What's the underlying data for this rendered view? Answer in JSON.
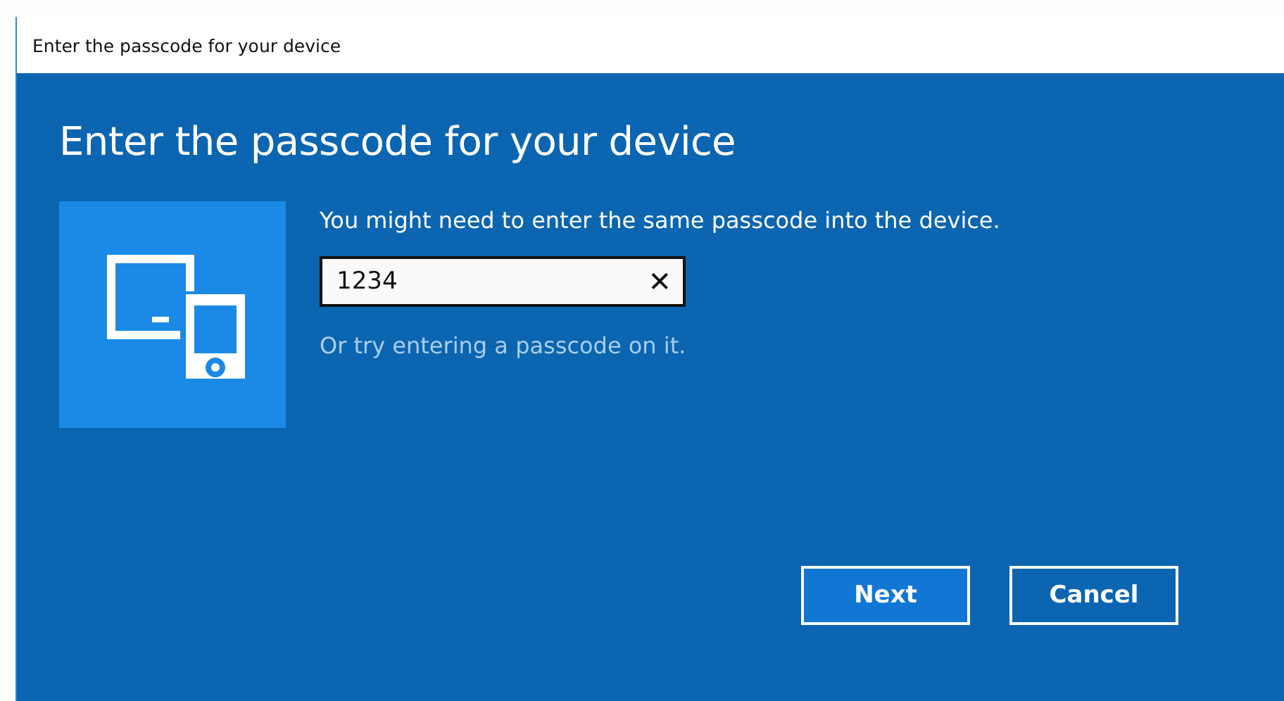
{
  "window": {
    "title": "Enter the passcode for your device"
  },
  "heading": "Enter the passcode for your device",
  "instruction": "You might need to enter the same passcode into the device.",
  "passcode_field": {
    "value": "1234",
    "clear_button": "✕"
  },
  "hint": "Or try entering a passcode on it.",
  "buttons": [
    {
      "label": "Next",
      "default": true
    },
    {
      "label": "Cancel",
      "default": false
    }
  ]
}
